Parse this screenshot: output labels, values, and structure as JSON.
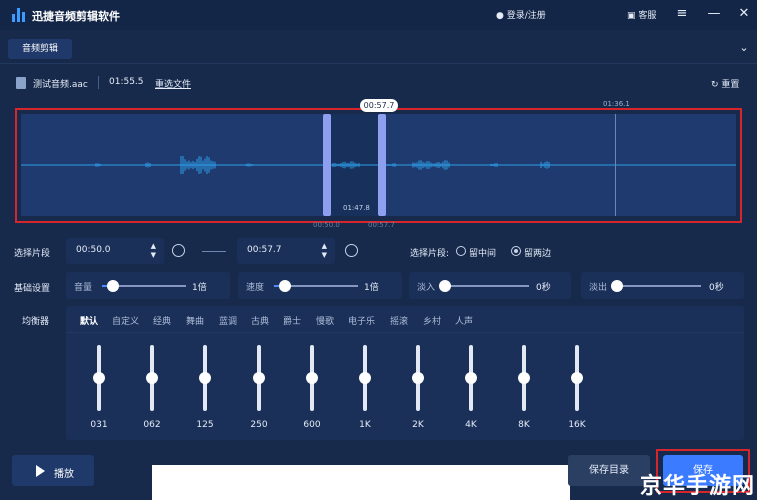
{
  "app": {
    "title": "迅捷音频剪辑软件",
    "login": "登录/注册",
    "service": "客服"
  },
  "tab": {
    "label": "音频剪辑"
  },
  "file": {
    "name": "测试音频.aac",
    "duration": "01:55.5",
    "reselect": "重选文件",
    "reset": "重置"
  },
  "waveform": {
    "cursor_time": "00:57.7",
    "playhead_time": "01:36.1",
    "selection_length": "01:47.8",
    "start_mark": "00:50.0",
    "end_mark": "00:57.7"
  },
  "segment": {
    "label": "选择片段",
    "start": "00:50.0",
    "end": "00:57.7",
    "mode_label": "选择片段:",
    "option_middle": "留中间",
    "option_both": "留两边",
    "selected": "留两边"
  },
  "basic": {
    "label": "基础设置",
    "volume": {
      "label": "音量",
      "value": "1倍",
      "level": 0.13
    },
    "speed": {
      "label": "速度",
      "value": "1倍",
      "level": 0.13
    },
    "fade_in": {
      "label": "淡入",
      "value": "0秒",
      "level": 0.0
    },
    "fade_out": {
      "label": "淡出",
      "value": "0秒",
      "level": 0.0
    }
  },
  "equalizer": {
    "label": "均衡器",
    "presets": [
      "默认",
      "自定义",
      "经典",
      "舞曲",
      "蓝调",
      "古典",
      "爵士",
      "慢歌",
      "电子乐",
      "摇滚",
      "乡村",
      "人声"
    ],
    "active_preset": "默认",
    "bands": [
      {
        "freq": "031",
        "level": 0.5
      },
      {
        "freq": "062",
        "level": 0.5
      },
      {
        "freq": "125",
        "level": 0.5
      },
      {
        "freq": "250",
        "level": 0.5
      },
      {
        "freq": "600",
        "level": 0.5
      },
      {
        "freq": "1K",
        "level": 0.5
      },
      {
        "freq": "2K",
        "level": 0.5
      },
      {
        "freq": "4K",
        "level": 0.5
      },
      {
        "freq": "8K",
        "level": 0.5
      },
      {
        "freq": "16K",
        "level": 0.5
      }
    ]
  },
  "bottom": {
    "play": "播放",
    "save_dir": "保存目录",
    "save": "保存"
  },
  "watermark": "京华手游网",
  "colors": {
    "accent": "#3a7bff",
    "highlight": "#d6252b",
    "waveform": "#2f9ee8",
    "handle": "#8e9ff0"
  }
}
